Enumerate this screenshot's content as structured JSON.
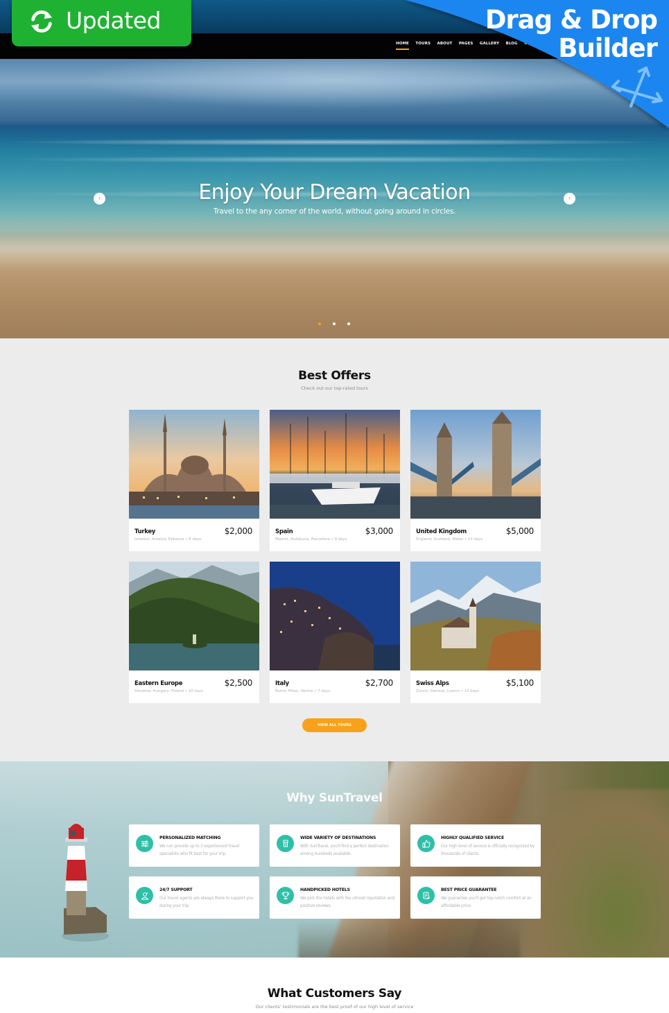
{
  "badges": {
    "updated_label": "Updated",
    "builder_line1": "Drag & Drop",
    "builder_line2": "Builder",
    "updated_color": "#1fb232",
    "builder_color": "#1b86f0"
  },
  "nav": {
    "items": [
      {
        "label": "HOME",
        "active": true
      },
      {
        "label": "TOURS"
      },
      {
        "label": "ABOUT"
      },
      {
        "label": "PAGES"
      },
      {
        "label": "GALLERY"
      },
      {
        "label": "BLOG"
      },
      {
        "label": "CO"
      }
    ],
    "accent": "#f7a11a"
  },
  "hero": {
    "title": "Enjoy Your Dream Vacation",
    "subtitle": "Travel to the any corner of the world, without going around in circles.",
    "prev_icon": "chevron-left-icon",
    "next_icon": "chevron-right-icon",
    "slides": 3,
    "active_slide": 1
  },
  "offers": {
    "title": "Best Offers",
    "subtitle": "Check out our top-rated tours",
    "cards": [
      {
        "name": "Turkey",
        "desc": "Istanbul, Antalya, Ephesus • 8 days",
        "price": "$2,000"
      },
      {
        "name": "Spain",
        "desc": "Madrid, Andalucia, Barcelona • 9 days",
        "price": "$3,000"
      },
      {
        "name": "United Kingdom",
        "desc": "England, Scotland, Wales • 13 days",
        "price": "$5,000"
      },
      {
        "name": "Eastern Europe",
        "desc": "Slovenia, Hungary, Poland • 10 days",
        "price": "$2,500"
      },
      {
        "name": "Italy",
        "desc": "Rome, Milan, Venice • 7 days",
        "price": "$2,700"
      },
      {
        "name": "Swiss Alps",
        "desc": "Zurich, Geneve, Luzern • 13 days",
        "price": "$5,100"
      }
    ],
    "button_label": "VIEW ALL TOURS",
    "button_color": "#f9a11b"
  },
  "why": {
    "title": "Why SunTravel",
    "icon_color": "#2fbfa8",
    "features": [
      {
        "title": "PERSONALIZED MATCHING",
        "desc": "We can provide up to 3 experienced travel specialists who fit best for your trip.",
        "icon": "sliders-icon"
      },
      {
        "title": "WIDE VARIETY OF DESTINATIONS",
        "desc": "With SunTravel, you'll find a perfect destination among hundreds available.",
        "icon": "map-marker-icon"
      },
      {
        "title": "HIGHLY QUALIFIED SERVICE",
        "desc": "Our high level of service is officially recognized by thousands of clients.",
        "icon": "thumbs-up-icon"
      },
      {
        "title": "24/7 SUPPORT",
        "desc": "Our travel agents are always there to support you during your trip.",
        "icon": "support-agent-icon"
      },
      {
        "title": "HANDPICKED HOTELS",
        "desc": "We pick the hotels with the utmost reputation and positive reviews.",
        "icon": "trophy-icon"
      },
      {
        "title": "BEST PRICE GUARANTEE",
        "desc": "We guarantee you'll get top-notch comfort at an affordable price.",
        "icon": "price-check-icon"
      }
    ]
  },
  "testimonials": {
    "title": "What Customers Say",
    "subtitle": "Our clients' testimonials are the best proof of our high level of service"
  }
}
